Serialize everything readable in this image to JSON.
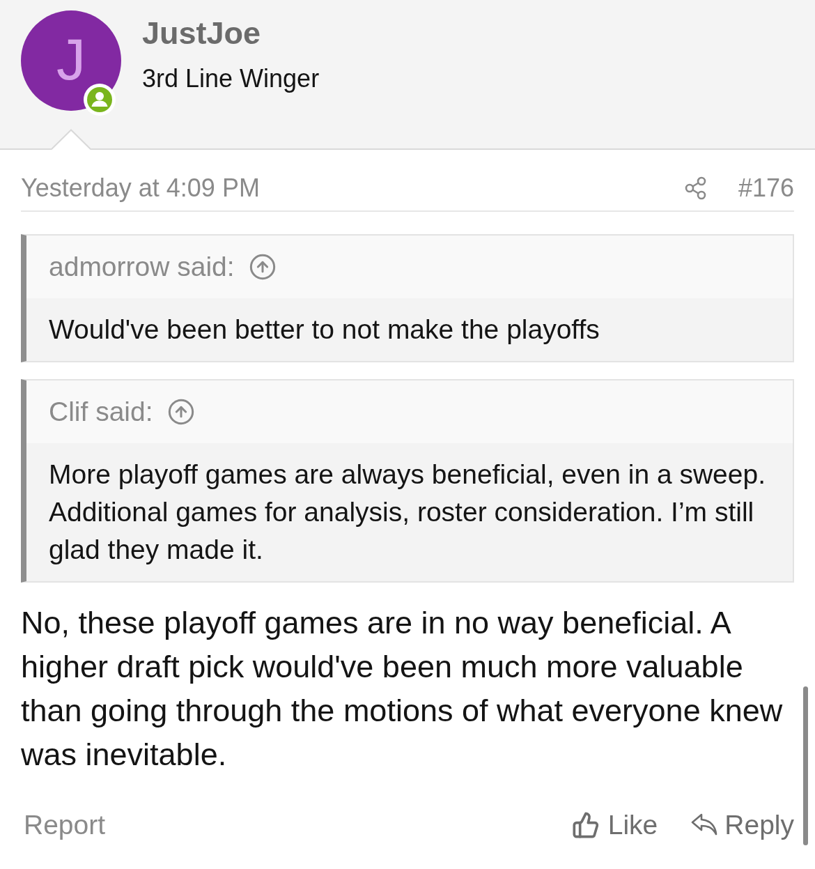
{
  "author": {
    "avatar_letter": "J",
    "name": "JustJoe",
    "title": "3rd Line Winger"
  },
  "post": {
    "timestamp": "Yesterday at 4:09 PM",
    "number": "#176"
  },
  "quotes": [
    {
      "attribution": "admorrow said:",
      "text": "Would've been better to not make the playoffs"
    },
    {
      "attribution": "Clif said:",
      "text": "More playoff games are always beneficial, even in a sweep. Additional games for analysis, roster consideration. I’m still glad they made it."
    }
  ],
  "message": "No, these playoff games are in no way beneficial. A higher draft pick would've been much more valuable than going through the motions of what everyone knew was inevitable.",
  "actions": {
    "report": "Report",
    "like": "Like",
    "reply": "Reply"
  }
}
